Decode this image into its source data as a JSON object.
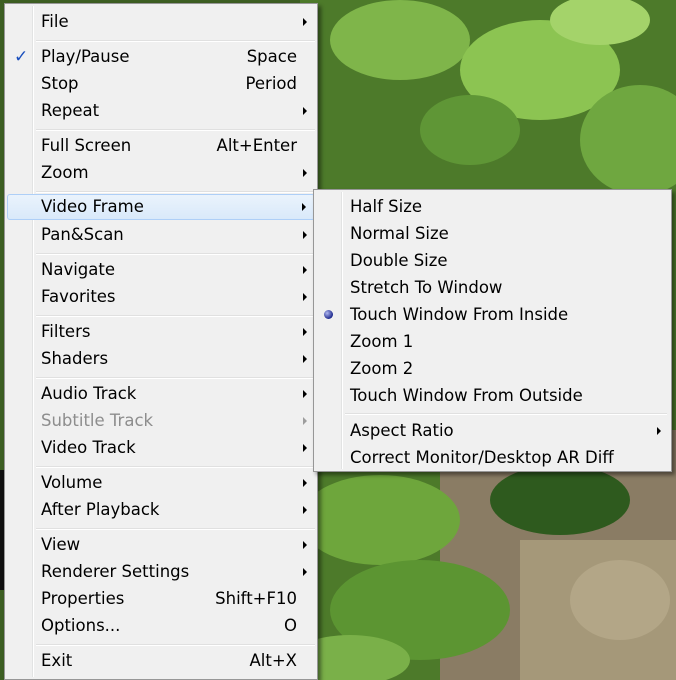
{
  "main_menu": {
    "items": [
      {
        "label": "File",
        "shortcut": "",
        "submenu": true
      },
      {
        "label": "Play/Pause",
        "shortcut": "Space",
        "checked": true
      },
      {
        "label": "Stop",
        "shortcut": "Period"
      },
      {
        "label": "Repeat",
        "shortcut": "",
        "submenu": true
      },
      {
        "label": "Full Screen",
        "shortcut": "Alt+Enter"
      },
      {
        "label": "Zoom",
        "shortcut": "",
        "submenu": true
      },
      {
        "label": "Video Frame",
        "shortcut": "",
        "submenu": true,
        "highlighted": true
      },
      {
        "label": "Pan&Scan",
        "shortcut": "",
        "submenu": true
      },
      {
        "label": "Navigate",
        "shortcut": "",
        "submenu": true
      },
      {
        "label": "Favorites",
        "shortcut": "",
        "submenu": true
      },
      {
        "label": "Filters",
        "shortcut": "",
        "submenu": true
      },
      {
        "label": "Shaders",
        "shortcut": "",
        "submenu": true
      },
      {
        "label": "Audio Track",
        "shortcut": "",
        "submenu": true
      },
      {
        "label": "Subtitle Track",
        "shortcut": "",
        "submenu": true,
        "disabled": true
      },
      {
        "label": "Video Track",
        "shortcut": "",
        "submenu": true
      },
      {
        "label": "Volume",
        "shortcut": "",
        "submenu": true
      },
      {
        "label": "After Playback",
        "shortcut": "",
        "submenu": true
      },
      {
        "label": "View",
        "shortcut": "",
        "submenu": true
      },
      {
        "label": "Renderer Settings",
        "shortcut": "",
        "submenu": true
      },
      {
        "label": "Properties",
        "shortcut": "Shift+F10"
      },
      {
        "label": "Options...",
        "shortcut": "O"
      },
      {
        "label": "Exit",
        "shortcut": "Alt+X"
      }
    ]
  },
  "video_frame_submenu": {
    "items": [
      {
        "label": "Half Size"
      },
      {
        "label": "Normal Size"
      },
      {
        "label": "Double Size"
      },
      {
        "label": "Stretch To Window"
      },
      {
        "label": "Touch Window From Inside",
        "selected": true
      },
      {
        "label": "Zoom 1"
      },
      {
        "label": "Zoom 2"
      },
      {
        "label": "Touch Window From Outside"
      },
      {
        "label": "Aspect Ratio",
        "submenu": true
      },
      {
        "label": "Correct Monitor/Desktop AR Diff"
      }
    ]
  },
  "colors": {
    "menu_background": "#f0f0f0",
    "highlight_fill": "#dce9fa",
    "highlight_border": "#aecff7",
    "check_mark": "#1a4fbd",
    "disabled_text": "#8d8d8d"
  },
  "icons": {
    "check": "check-icon",
    "radio": "radio-bullet-icon",
    "submenu": "submenu-arrow-icon"
  }
}
